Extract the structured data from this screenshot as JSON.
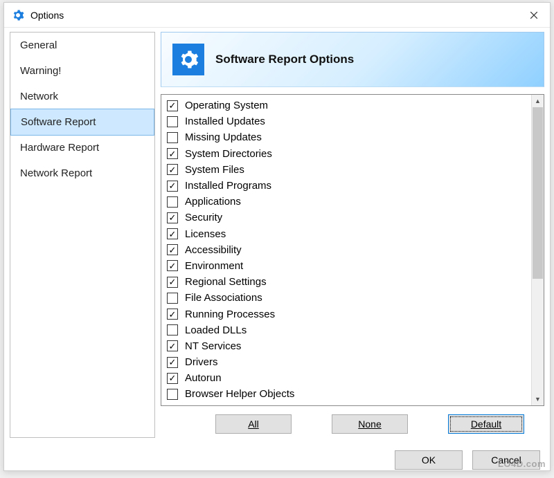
{
  "window": {
    "title": "Options"
  },
  "sidebar": {
    "items": [
      {
        "label": "General",
        "selected": false
      },
      {
        "label": "Warning!",
        "selected": false
      },
      {
        "label": "Network",
        "selected": false
      },
      {
        "label": "Software Report",
        "selected": true
      },
      {
        "label": "Hardware Report",
        "selected": false
      },
      {
        "label": "Network Report",
        "selected": false
      }
    ]
  },
  "banner": {
    "title": "Software Report Options"
  },
  "checklist": {
    "items": [
      {
        "label": "Operating System",
        "checked": true
      },
      {
        "label": "Installed Updates",
        "checked": false
      },
      {
        "label": "Missing Updates",
        "checked": false
      },
      {
        "label": "System Directories",
        "checked": true
      },
      {
        "label": "System Files",
        "checked": true
      },
      {
        "label": "Installed Programs",
        "checked": true
      },
      {
        "label": "Applications",
        "checked": false
      },
      {
        "label": "Security",
        "checked": true
      },
      {
        "label": "Licenses",
        "checked": true
      },
      {
        "label": "Accessibility",
        "checked": true
      },
      {
        "label": "Environment",
        "checked": true
      },
      {
        "label": "Regional Settings",
        "checked": true
      },
      {
        "label": "File Associations",
        "checked": false
      },
      {
        "label": "Running Processes",
        "checked": true
      },
      {
        "label": "Loaded DLLs",
        "checked": false
      },
      {
        "label": "NT Services",
        "checked": true
      },
      {
        "label": "Drivers",
        "checked": true
      },
      {
        "label": "Autorun",
        "checked": true
      },
      {
        "label": "Browser Helper Objects",
        "checked": false
      }
    ]
  },
  "buttons": {
    "all": "All",
    "none": "None",
    "default": "Default",
    "ok": "OK",
    "cancel": "Cancel"
  },
  "watermark": "LO4D.com"
}
